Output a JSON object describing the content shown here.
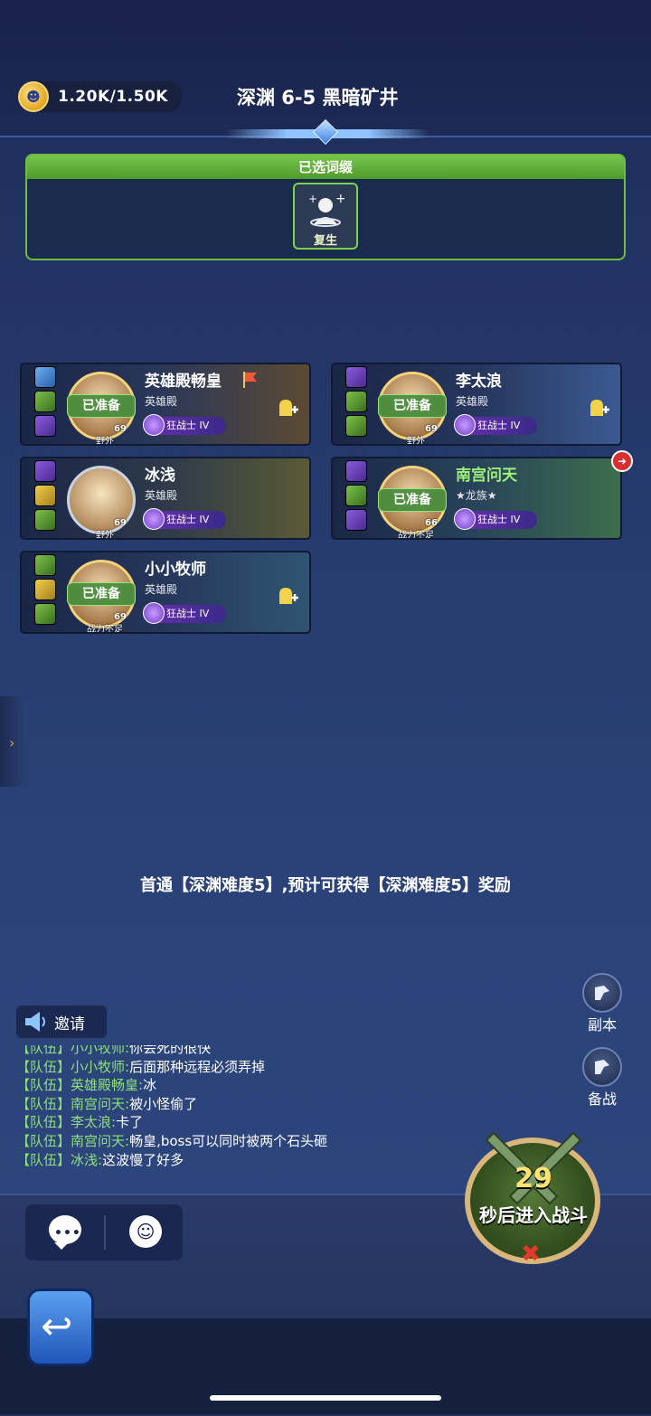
{
  "header": {
    "stamina": "1.20K/1.50K",
    "stage_title": "深渊 6-5 黑暗矿井"
  },
  "affix": {
    "title": "已选词缀",
    "items": [
      {
        "label": "复生",
        "icon": "revive-icon"
      }
    ]
  },
  "players": [
    {
      "name": "英雄殿畅皇",
      "guild": "英雄殿",
      "status": "已准备",
      "class": "狂战士",
      "tier": "IV",
      "level": "69",
      "tag": "野外",
      "leader": true
    },
    {
      "name": "李太浪",
      "guild": "英雄殿",
      "status": "已准备",
      "class": "狂战士",
      "tier": "IV",
      "level": "69",
      "tag": "野外"
    },
    {
      "name": "冰浅",
      "guild": "英雄殿",
      "status": "",
      "class": "狂战士",
      "tier": "IV",
      "level": "69",
      "tag": "野外"
    },
    {
      "name": "南宫问天",
      "guild": "★龙族★",
      "status": "已准备",
      "class": "狂战士",
      "tier": "IV",
      "level": "66",
      "tag": "战力不足"
    },
    {
      "name": "小小牧师",
      "guild": "英雄殿",
      "status": "已准备",
      "class": "狂战士",
      "tier": "IV",
      "level": "69",
      "tag": "战力不足"
    }
  ],
  "notice": "首通【深渊难度5】,预计可获得【深渊难度5】奖励",
  "side_buttons": {
    "dungeon": "副本",
    "prepare": "备战"
  },
  "invite_label": "邀请",
  "chat": [
    {
      "channel": "【队伍】",
      "name": "小小牧师:",
      "text": "你会死的很快"
    },
    {
      "channel": "【队伍】",
      "name": "小小牧师:",
      "text": "后面那种远程必须弄掉"
    },
    {
      "channel": "【队伍】",
      "name": "英雄殿畅皇:",
      "text": "冰"
    },
    {
      "channel": "【队伍】",
      "name": "南宫问天:",
      "text": "被小怪偷了"
    },
    {
      "channel": "【队伍】",
      "name": "李太浪:",
      "text": "卡了"
    },
    {
      "channel": "【队伍】",
      "name": "南宫问天:",
      "text": "畅皇,boss可以同时被两个石头砸"
    },
    {
      "channel": "【队伍】",
      "name": "冰浅:",
      "text": "这波慢了好多"
    }
  ],
  "battle": {
    "countdown": "29",
    "label": "秒后进入战斗"
  },
  "icons": [
    "coin-icon",
    "revive-icon",
    "flag-icon",
    "invite-friend-icon",
    "exit-icon",
    "speaker-icon",
    "chat-bubble-icon",
    "smile-icon",
    "back-arrow-icon",
    "swords-icon",
    "cancel-icon"
  ]
}
